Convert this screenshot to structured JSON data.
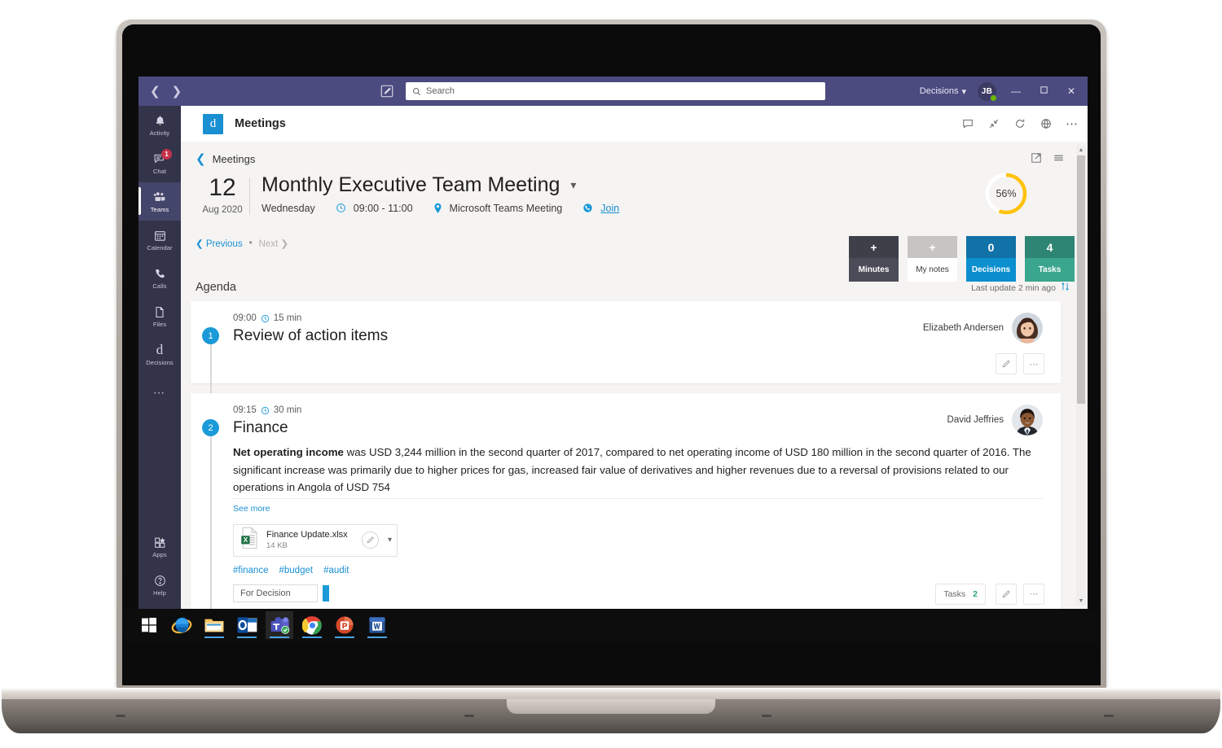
{
  "titlebar": {
    "back_icon": "chevron-left-icon",
    "forward_icon": "chevron-right-icon",
    "compose_icon": "compose-icon",
    "search_placeholder": "Search",
    "search_value": "",
    "search_icon": "search-icon",
    "org_name": "Decisions",
    "org_chevron": "chevron-down-icon",
    "avatar_initials": "JB",
    "minimize": "—",
    "maximize": "❐",
    "close": "✕",
    "bg_color": "#4b4b80"
  },
  "rail": {
    "items": [
      {
        "label": "Activity",
        "icon": "bell-icon",
        "badge": null,
        "active": false
      },
      {
        "label": "Chat",
        "icon": "chat-icon",
        "badge": "1",
        "active": false
      },
      {
        "label": "Teams",
        "icon": "teams-icon",
        "badge": null,
        "active": true
      },
      {
        "label": "Calendar",
        "icon": "calendar-icon",
        "badge": null,
        "active": false
      },
      {
        "label": "Calls",
        "icon": "phone-icon",
        "badge": null,
        "active": false
      },
      {
        "label": "Files",
        "icon": "files-icon",
        "badge": null,
        "active": false
      },
      {
        "label": "Decisions",
        "icon": "decisions-d-icon",
        "badge": null,
        "active": false
      }
    ],
    "more_icon": "ellipsis-icon",
    "bottom": [
      {
        "label": "Apps",
        "icon": "apps-icon"
      },
      {
        "label": "Help",
        "icon": "help-icon"
      }
    ]
  },
  "apphead": {
    "logo_letter": "d",
    "logo_color": "#1a8fd1",
    "title": "Meetings",
    "icons": [
      "chat-bubble-icon",
      "collapse-icon",
      "refresh-icon",
      "globe-icon",
      "ellipsis-icon"
    ]
  },
  "breadcrumb": {
    "back_chevron": "chevron-left-icon",
    "label": "Meetings",
    "tools": [
      "popout-icon",
      "list-view-icon"
    ]
  },
  "meeting": {
    "day": "12",
    "month_year": "Aug 2020",
    "title": "Monthly Executive Team Meeting",
    "title_chevron": "chevron-down-icon",
    "weekday": "Wednesday",
    "clock_icon": "clock-icon",
    "time_range": "09:00 - 11:00",
    "location_icon": "location-pin-icon",
    "location": "Microsoft Teams Meeting",
    "join_icon": "join-call-icon",
    "join_label": "Join",
    "previous_label": "Previous",
    "previous_chevron": "chevron-left-icon",
    "dot": "•",
    "next_label": "Next",
    "next_chevron": "chevron-right-icon"
  },
  "progress": {
    "percent_label": "56%",
    "percent_value": 56,
    "ring_color": "#ffc20e",
    "track_color": "#ffffff"
  },
  "stats": [
    {
      "key": "minutes",
      "top_value": "+",
      "label": "Minutes",
      "top_color": "#3f3f4a",
      "bottom_color": "#4c4c58"
    },
    {
      "key": "notes",
      "top_value": "+",
      "label": "My notes",
      "top_color": "#c6c5c4",
      "bottom_color": "#ffffff"
    },
    {
      "key": "decisions",
      "top_value": "0",
      "label": "Decisions",
      "top_color": "#1072a6",
      "bottom_color": "#0b8fce"
    },
    {
      "key": "tasks",
      "top_value": "4",
      "label": "Tasks",
      "top_color": "#2e8573",
      "bottom_color": "#3aa68d"
    }
  ],
  "agenda": {
    "section_title": "Agenda",
    "last_update": "Last update 2 min ago",
    "sort_icon": "sort-icon",
    "items": [
      {
        "number": "1",
        "time": "09:00",
        "clock_icon": "clock-icon",
        "duration": "15 min",
        "heading": "Review of action items",
        "owner": "Elizabeth Andersen",
        "avatar": "avatar-elizabeth",
        "edit_icon": "pencil-icon",
        "more_icon": "ellipsis-icon"
      },
      {
        "number": "2",
        "time": "09:15",
        "clock_icon": "clock-icon",
        "duration": "30 min",
        "heading": "Finance",
        "owner": "David Jeffries",
        "avatar": "avatar-david",
        "body_bold": "Net operating income",
        "body_text": " was USD 3,244 million in the second quarter of 2017, compared to net operating income of USD 180 million in the second quarter of 2016. The significant increase was primarily due to higher prices for gas, increased fair value of derivatives and higher revenues due to a reversal of provisions related to our operations in Angola of USD 754",
        "see_more": "See more",
        "file": {
          "name": "Finance Update.xlsx",
          "size": "14 KB",
          "icon": "excel-file-icon",
          "pen_icon": "pencil-circle-icon",
          "chevron": "chevron-down-icon"
        },
        "tags": [
          "#finance",
          "#budget",
          "#audit"
        ],
        "decision_select": "For Decision",
        "tasks_label": "Tasks",
        "tasks_count": "2",
        "edit_icon": "pencil-icon",
        "more_icon": "ellipsis-icon"
      }
    ]
  },
  "scrollbar": {
    "up_arrow": "triangle-up-icon",
    "down_arrow": "triangle-down-icon"
  },
  "taskbar": {
    "apps": [
      {
        "name": "windows-start-icon",
        "active": false,
        "running": false
      },
      {
        "name": "internet-explorer-icon",
        "active": false,
        "running": false
      },
      {
        "name": "file-explorer-icon",
        "active": false,
        "running": true
      },
      {
        "name": "outlook-icon",
        "active": false,
        "running": true
      },
      {
        "name": "microsoft-teams-icon",
        "active": true,
        "running": true
      },
      {
        "name": "google-chrome-icon",
        "active": false,
        "running": true
      },
      {
        "name": "powerpoint-icon",
        "active": false,
        "running": true
      },
      {
        "name": "word-icon",
        "active": false,
        "running": true
      }
    ]
  }
}
